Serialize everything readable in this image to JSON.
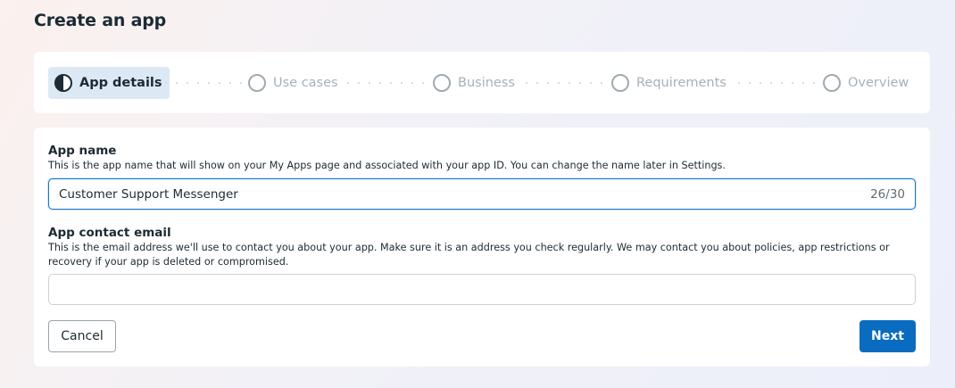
{
  "page": {
    "title": "Create an app"
  },
  "stepper": {
    "steps": [
      {
        "label": "App details",
        "state": "active"
      },
      {
        "label": "Use cases",
        "state": "pending"
      },
      {
        "label": "Business",
        "state": "pending"
      },
      {
        "label": "Requirements",
        "state": "pending"
      },
      {
        "label": "Overview",
        "state": "pending"
      }
    ]
  },
  "form": {
    "app_name": {
      "label": "App name",
      "help": "This is the app name that will show on your My Apps page and associated with your app ID. You can change the name later in Settings.",
      "value": "Customer Support Messenger",
      "counter": "26/30"
    },
    "contact_email": {
      "label": "App contact email",
      "help": "This is the email address we'll use to contact you about your app. Make sure it is an address you check regularly. We may contact you about policies, app restrictions or recovery if your app is deleted or compromised.",
      "value": ""
    }
  },
  "actions": {
    "cancel_label": "Cancel",
    "next_label": "Next"
  },
  "colors": {
    "primary": "#0a6cc0",
    "focus_border": "#1877c9",
    "active_step_bg": "#dce9f5"
  }
}
